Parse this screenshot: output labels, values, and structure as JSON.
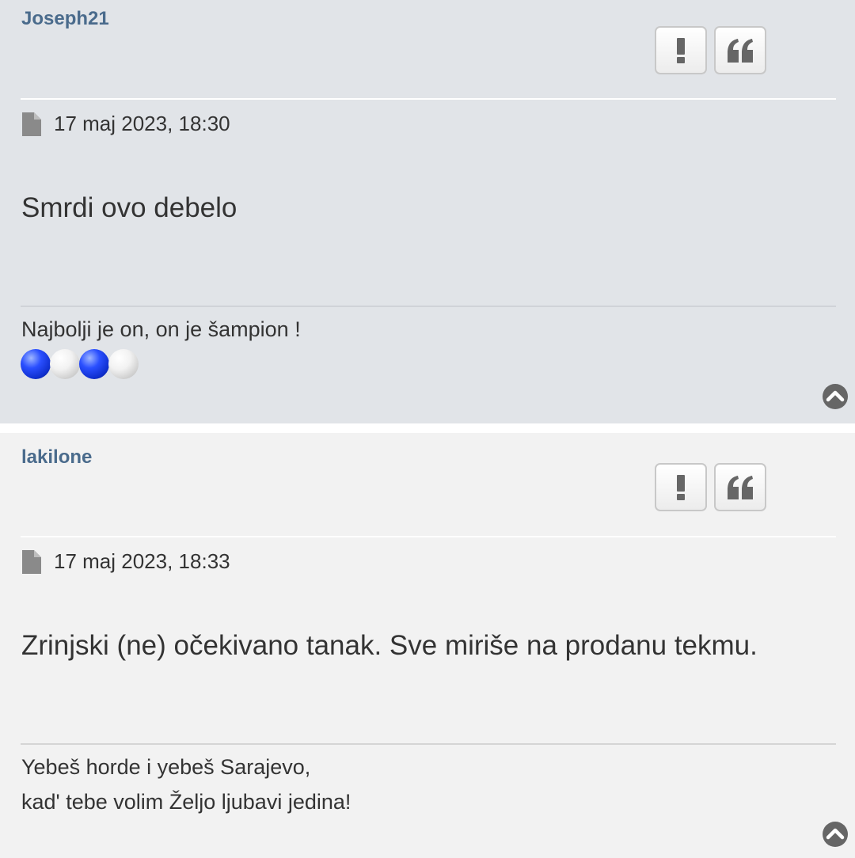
{
  "posts": [
    {
      "author": "Joseph21",
      "date": "17 maj 2023, 18:30",
      "content": "Smrdi ovo debelo",
      "signature": [
        "Najbolji je on, on je šampion !"
      ],
      "signature_balls": [
        "blue",
        "white",
        "blue",
        "white"
      ]
    },
    {
      "author": "lakilone",
      "date": "17 maj 2023, 18:33",
      "content": "Zrinjski (ne) očekivano tanak. Sve miriše na prodanu tekmu.",
      "signature": [
        "Yebeš horde i yebeš Sarajevo,",
        "kad' tebe volim Željo ljubavi jedina!"
      ]
    }
  ],
  "icons": {
    "report": "exclamation-icon",
    "quote": "quote-icon",
    "post_link": "document-icon",
    "back_to_top": "chevron-up-circle-icon"
  },
  "colors": {
    "author": "#4a6b8c",
    "post1_bg": "#e1e4e8",
    "post2_bg": "#f2f2f2",
    "icon_gray": "#666666"
  }
}
